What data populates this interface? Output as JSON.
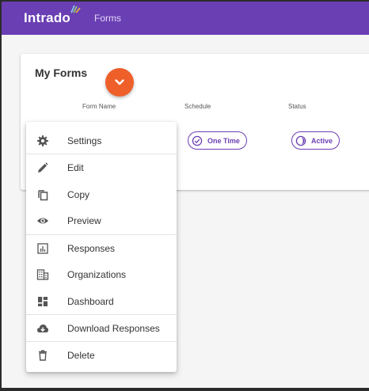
{
  "header": {
    "brand": "Intrado",
    "app_title": "Forms",
    "color": "#6a3fb3"
  },
  "card": {
    "title": "My Forms",
    "columns": [
      "Form Name",
      "Schedule",
      "Status"
    ],
    "schedule_chip": "One Time",
    "status_chip": "Active"
  },
  "fab": {
    "icon": "chevron-down-icon",
    "color": "#ee5f2a"
  },
  "menu": {
    "items": [
      {
        "label": "Settings",
        "icon": "gear-icon"
      },
      {
        "label": "Edit",
        "icon": "pencil-icon"
      },
      {
        "label": "Copy",
        "icon": "copy-icon"
      },
      {
        "label": "Preview",
        "icon": "eye-icon"
      },
      {
        "label": "Responses",
        "icon": "bar-chart-icon"
      },
      {
        "label": "Organizations",
        "icon": "building-icon"
      },
      {
        "label": "Dashboard",
        "icon": "dashboard-icon"
      },
      {
        "label": "Download Responses",
        "icon": "cloud-download-icon"
      },
      {
        "label": "Delete",
        "icon": "trash-icon"
      }
    ]
  }
}
